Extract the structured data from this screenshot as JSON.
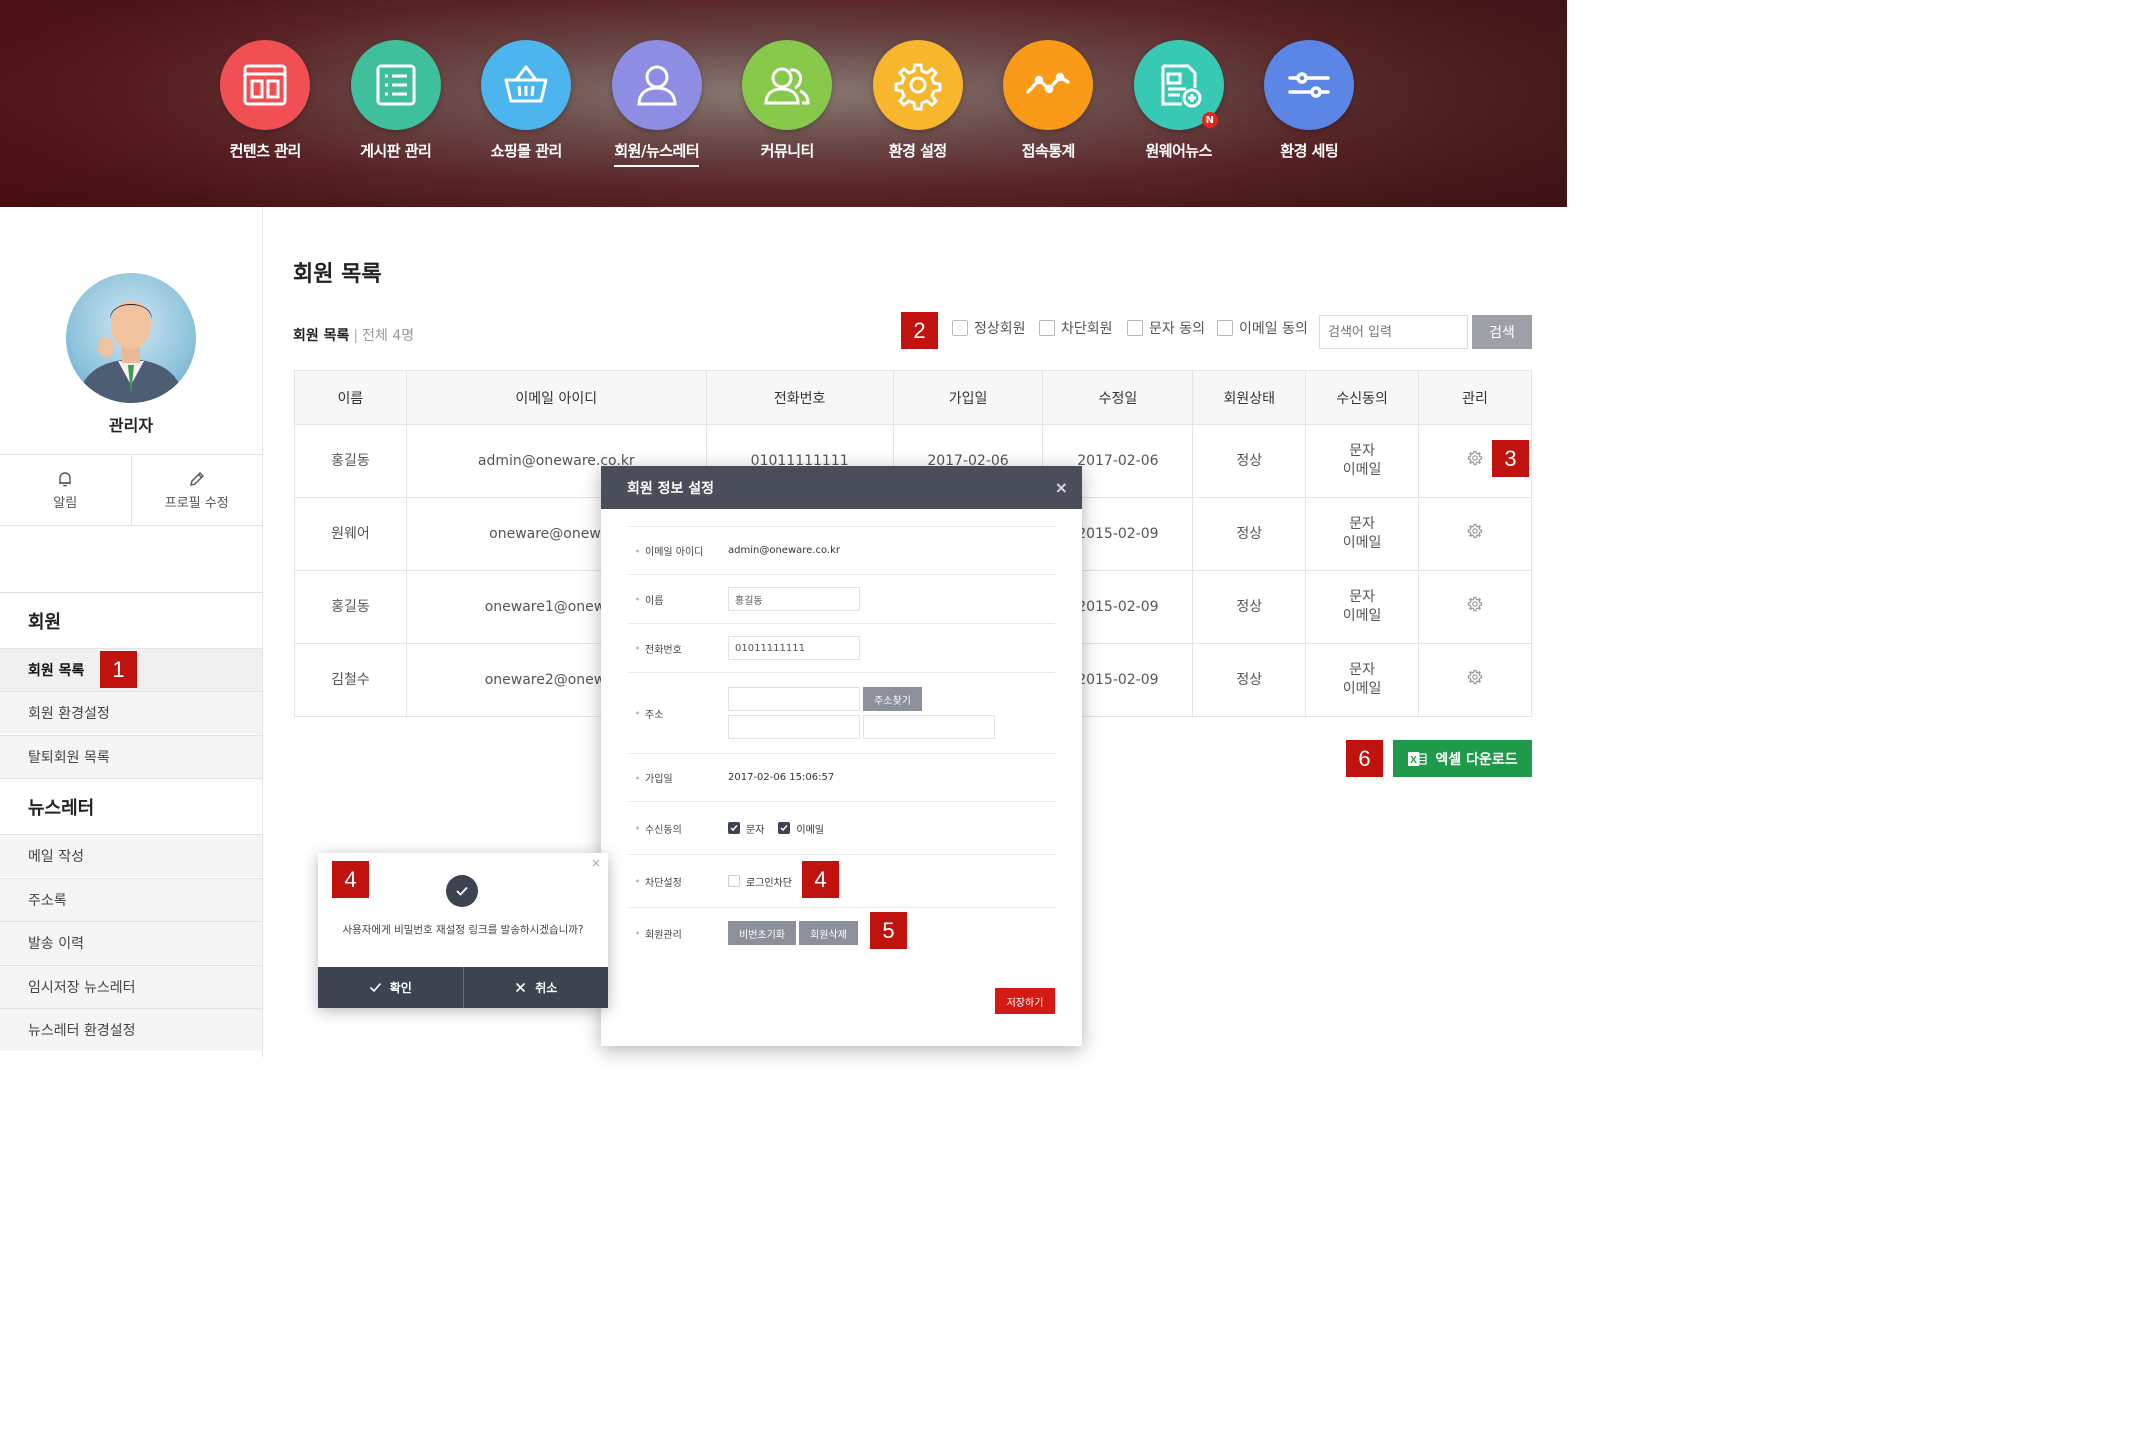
{
  "nav": {
    "items": [
      {
        "label": "컨텐츠 관리",
        "icon": "layout-icon",
        "color": "#f04f53"
      },
      {
        "label": "게시판 관리",
        "icon": "list-icon",
        "color": "#3fbf9b"
      },
      {
        "label": "쇼핑몰 관리",
        "icon": "basket-icon",
        "color": "#4db5ee"
      },
      {
        "label": "회원/뉴스레터",
        "icon": "user-icon",
        "color": "#8d8ee3",
        "active": true
      },
      {
        "label": "커뮤니티",
        "icon": "users-icon",
        "color": "#88c84a"
      },
      {
        "label": "환경 설정",
        "icon": "gear-icon",
        "color": "#f8b52e"
      },
      {
        "label": "접속통계",
        "icon": "chart-line-icon",
        "color": "#f99a18"
      },
      {
        "label": "원웨어뉴스",
        "icon": "news-icon",
        "color": "#37c9b4",
        "badge": "N"
      },
      {
        "label": "환경 세팅",
        "icon": "sliders-icon",
        "color": "#5b86e5"
      }
    ]
  },
  "sidebar": {
    "profile_name": "관리자",
    "actions": [
      {
        "label": "알림",
        "icon": "bell-icon"
      },
      {
        "label": "프로필 수정",
        "icon": "pencil-icon"
      }
    ],
    "section_member": "회원",
    "member_links": [
      "회원 목록",
      "회원 환경설정",
      "탈퇴회원 목록"
    ],
    "section_newsletter": "뉴스레터",
    "newsletter_links": [
      "메일 작성",
      "주소록",
      "발송 이력",
      "임시저장 뉴스레터",
      "뉴스레터 환경설정"
    ]
  },
  "main": {
    "page_title": "회원 목록",
    "caption": "회원 목록",
    "caption_sep": "|",
    "caption_count": "전체 4명",
    "filters": [
      "정상회원",
      "차단회원",
      "문자 동의",
      "이메일 동의"
    ],
    "search_placeholder": "검색어 입력",
    "search_label": "검색",
    "table": {
      "headers": [
        "이름",
        "이메일 아이디",
        "전화번호",
        "가입일",
        "수정일",
        "회원상태",
        "수신동의",
        "관리"
      ],
      "rows": [
        {
          "name": "홍길동",
          "email": "admin@oneware.co.kr",
          "phone": "01011111111",
          "joined": "2017-02-06",
          "modified": "2017-02-06",
          "status": "정상",
          "consent_sms": "문자",
          "consent_email": "이메일"
        },
        {
          "name": "원웨어",
          "email": "oneware@oneware",
          "phone": "",
          "joined": "",
          "modified": "2015-02-09",
          "status": "정상",
          "consent_sms": "문자",
          "consent_email": "이메일"
        },
        {
          "name": "홍길동",
          "email": "oneware1@oneware",
          "phone": "",
          "joined": "",
          "modified": "2015-02-09",
          "status": "정상",
          "consent_sms": "문자",
          "consent_email": "이메일"
        },
        {
          "name": "김철수",
          "email": "oneware2@oneware",
          "phone": "",
          "joined": "",
          "modified": "2015-02-09",
          "status": "정상",
          "consent_sms": "문자",
          "consent_email": "이메일"
        }
      ]
    },
    "excel_label": "엑셀 다운로드"
  },
  "modal": {
    "title": "회원 정보 설정",
    "close": "×",
    "email_label": "이메일 아이디",
    "email_value": "admin@oneware.co.kr",
    "name_label": "이름",
    "name_value": "홍길동",
    "phone_label": "전화번호",
    "phone_value": "01011111111",
    "address_label": "주소",
    "address_button": "주소찾기",
    "joined_label": "가입일",
    "joined_value": "2017-02-06 15:06:57",
    "consent_label": "수신동의",
    "consent_sms": "문자",
    "consent_email": "이메일",
    "block_label": "차단설정",
    "block_option": "로그인차단",
    "manage_label": "회원관리",
    "reset_button": "비번초기화",
    "delete_button": "회원삭제",
    "save_button": "저장하기"
  },
  "confirm": {
    "close": "×",
    "message": "사용자에게 비밀번호 재설정 링크를 발송하시겠습니까?",
    "ok": "확인",
    "cancel": "취소"
  },
  "markers": [
    "1",
    "2",
    "3",
    "4",
    "4",
    "5",
    "6"
  ]
}
